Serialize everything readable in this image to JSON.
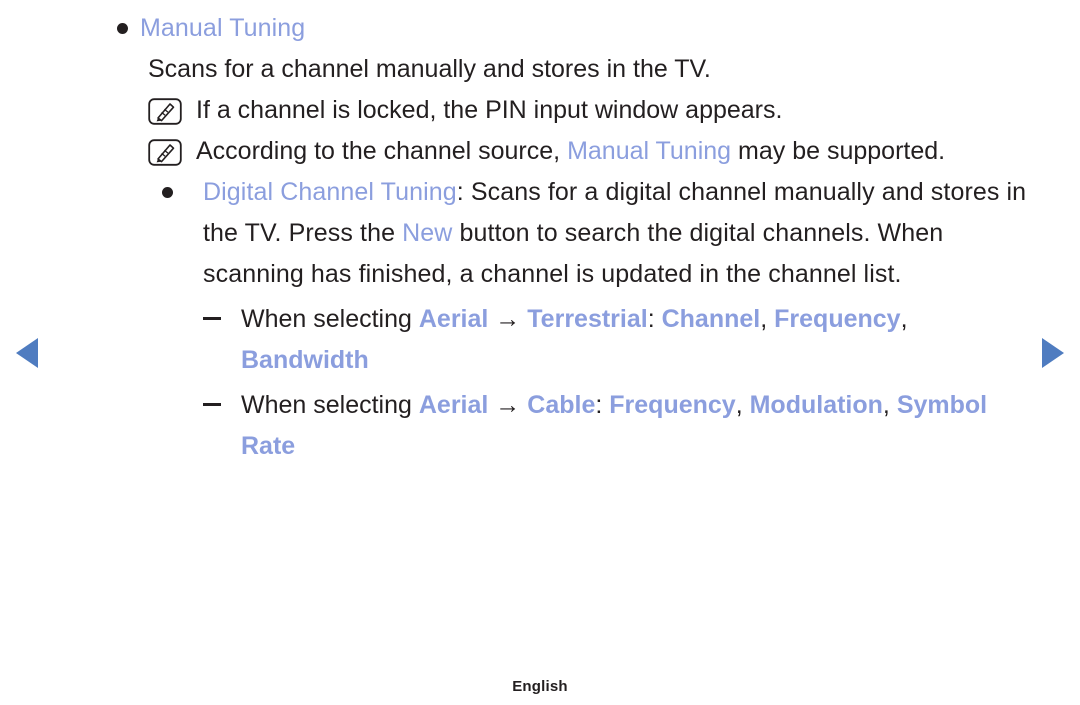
{
  "colors": {
    "accent_blue": "#8b9ede",
    "arrow_blue": "#4f7cc0",
    "text_dark": "#231f20"
  },
  "nav": {
    "prev_label": "previous-page",
    "next_label": "next-page",
    "prev_icon": "triangle-left-icon",
    "next_icon": "triangle-right-icon"
  },
  "sections": {
    "manual_tuning": {
      "bullet": "●",
      "title": "Manual Tuning",
      "description": "Scans for a channel manually and stores in the TV.",
      "notes": [
        {
          "icon": "note-pencil-icon",
          "text": "If a channel is locked, the PIN input window appears."
        },
        {
          "icon": "note-pencil-icon",
          "prefix": "According to the channel source, ",
          "term": "Manual Tuning",
          "suffix": " may be supported."
        }
      ]
    },
    "digital_channel_tuning": {
      "bullet": "●",
      "term": "Digital Channel Tuning",
      "colon": ":",
      "body_part1": " Scans for a digital channel manually and stores in the TV. Press the ",
      "inline_term": "New",
      "body_part2": " button to search the digital channels. When scanning has finished, a channel is updated in the channel list.",
      "sub_items": [
        {
          "dash": "–",
          "lead": "When selecting ",
          "source": "Aerial",
          "arrow": " → ",
          "mode": "Terrestrial",
          "colon": ": ",
          "options": [
            "Channel",
            "Frequency",
            "Bandwidth"
          ],
          "separator": ", "
        },
        {
          "dash": "–",
          "lead": "When selecting ",
          "source": "Aerial",
          "arrow": " → ",
          "mode": "Cable",
          "colon": ": ",
          "options": [
            "Frequency",
            "Modulation",
            "Symbol Rate"
          ],
          "separator": ", "
        }
      ]
    }
  },
  "footer": {
    "language": "English"
  }
}
